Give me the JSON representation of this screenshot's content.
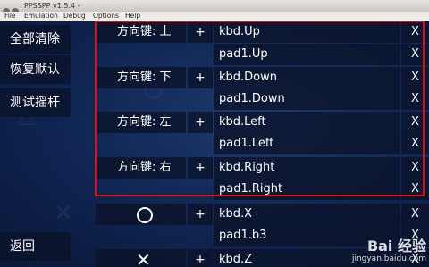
{
  "window": {
    "title": "PPSSPP v1.5.4 -"
  },
  "menu": [
    "File",
    "Emulation",
    "Debug",
    "Options",
    "Help"
  ],
  "sidebar": {
    "clear_all": "全部清除",
    "restore_default": "恢复默认",
    "test_analog": "测试摇杆",
    "back": "返回"
  },
  "rows": [
    {
      "label": "方向键: 上",
      "bind": "kbd.Up"
    },
    {
      "bind": "pad1.Up"
    },
    {
      "label": "方向键: 下",
      "bind": "kbd.Down"
    },
    {
      "bind": "pad1.Down"
    },
    {
      "label": "方向键: 左",
      "bind": "kbd.Left"
    },
    {
      "bind": "pad1.Left"
    },
    {
      "label": "方向键: 右",
      "bind": "kbd.Right"
    },
    {
      "bind": "pad1.Right"
    },
    {
      "label_icon": "circle-icon",
      "bind": "kbd.X"
    },
    {
      "bind": "pad1.b3"
    },
    {
      "label_icon": "cross-icon",
      "bind": "kbd.Z"
    }
  ],
  "row_controls": {
    "add": "+",
    "remove": "X"
  },
  "watermark": {
    "brand": "Bai 经验",
    "url": "jingyan.baidu.com"
  },
  "colors": {
    "highlight": "#e01010",
    "button_bg": "#0a1228"
  }
}
